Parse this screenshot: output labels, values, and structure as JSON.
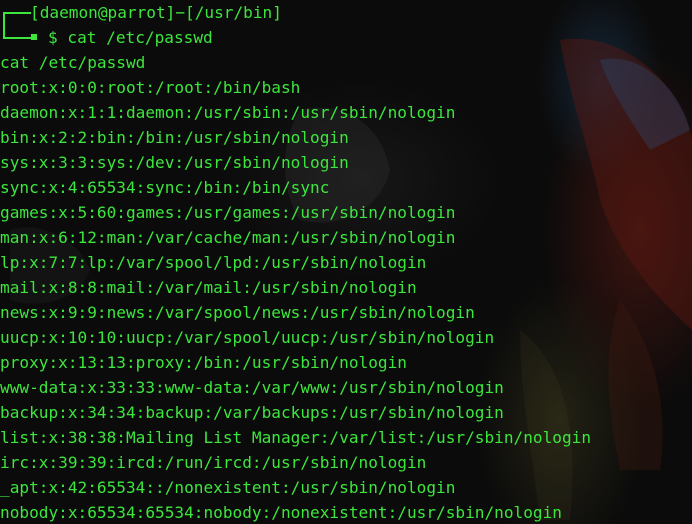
{
  "prompt": {
    "user_host_dir": "[daemon@parrot]−[/usr/bin]",
    "symbol": "$",
    "command": "cat /etc/passwd"
  },
  "output_lines": [
    "cat /etc/passwd",
    "root:x:0:0:root:/root:/bin/bash",
    "daemon:x:1:1:daemon:/usr/sbin:/usr/sbin/nologin",
    "bin:x:2:2:bin:/bin:/usr/sbin/nologin",
    "sys:x:3:3:sys:/dev:/usr/sbin/nologin",
    "sync:x:4:65534:sync:/bin:/bin/sync",
    "games:x:5:60:games:/usr/games:/usr/sbin/nologin",
    "man:x:6:12:man:/var/cache/man:/usr/sbin/nologin",
    "lp:x:7:7:lp:/var/spool/lpd:/usr/sbin/nologin",
    "mail:x:8:8:mail:/var/mail:/usr/sbin/nologin",
    "news:x:9:9:news:/var/spool/news:/usr/sbin/nologin",
    "uucp:x:10:10:uucp:/var/spool/uucp:/usr/sbin/nologin",
    "proxy:x:13:13:proxy:/bin:/usr/sbin/nologin",
    "www-data:x:33:33:www-data:/var/www:/usr/sbin/nologin",
    "backup:x:34:34:backup:/var/backups:/usr/sbin/nologin",
    "list:x:38:38:Mailing List Manager:/var/list:/usr/sbin/nologin",
    "irc:x:39:39:ircd:/run/ircd:/usr/sbin/nologin",
    "_apt:x:42:65534::/nonexistent:/usr/sbin/nologin",
    "nobody:x:65534:65534:nobody:/nonexistent:/usr/sbin/nologin"
  ],
  "colors": {
    "text": "#3de63d",
    "background": "#0b0b0b"
  }
}
